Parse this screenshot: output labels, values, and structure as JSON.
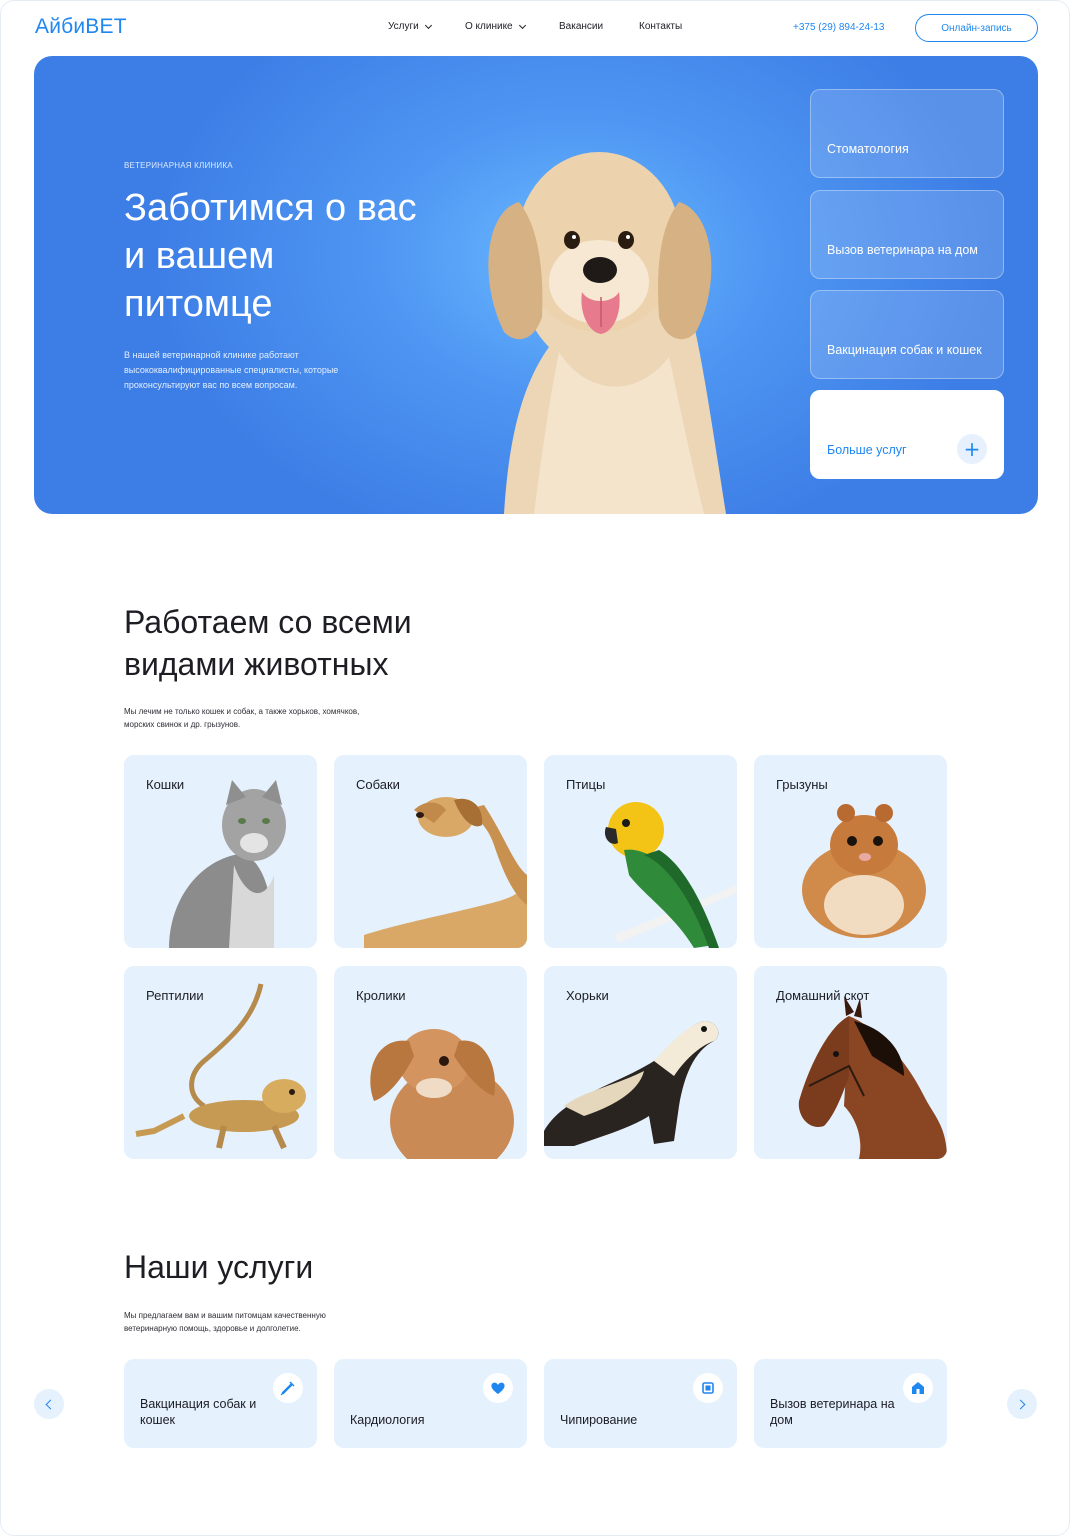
{
  "header": {
    "logo": "АйбиВЕТ",
    "nav": {
      "services": "Услуги",
      "clinic": "О клинике",
      "vacancies": "Вакансии",
      "contacts": "Контакты"
    },
    "phone": "+375 (29) 894-24-13",
    "cta": "Онлайн-запись"
  },
  "hero": {
    "eyebrow": "ВЕТЕРИНАРНАЯ КЛИНИКА",
    "title": "Заботимся о вас и вашем питомце",
    "description": "В нашей ветеринарной клинике работают высококвалифицированные специалисты, которые проконсультируют вас по всем вопросам.",
    "cards": [
      "Стоматология",
      "Вызов ветеринара на дом",
      "Вакцинация собак и кошек"
    ],
    "more": "Больше услуг"
  },
  "animals": {
    "title": "Работаем со всеми видами животных",
    "description": "Мы лечим не только кошек и собак, а также хорьков, хомячков, морских свинок и др. грызунов.",
    "items": [
      "Кошки",
      "Собаки",
      "Птицы",
      "Грызуны",
      "Рептилии",
      "Кролики",
      "Хорьки",
      "Домашний скот"
    ]
  },
  "services": {
    "title": "Наши услуги",
    "description": "Мы предлагаем вам и вашим питомцам качественную ветеринарную помощь, здоровье и долголетие.",
    "items": [
      "Вакцинация собак и кошек",
      "Кардиология",
      "Чипирование",
      "Вызов ветеринара на дом"
    ]
  },
  "colors": {
    "accent": "#1f87f0",
    "hero_bg": "#4f97f3",
    "tile_bg": "#e5f1fd"
  }
}
